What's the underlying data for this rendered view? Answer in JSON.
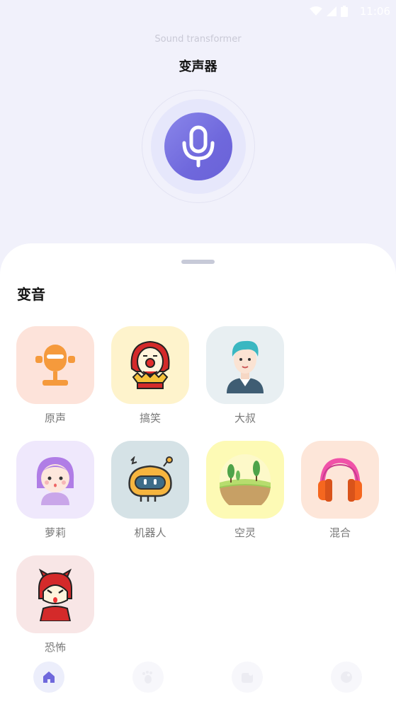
{
  "status": {
    "time": "11:06"
  },
  "header": {
    "subtitle": "Sound transformer",
    "title": "变声器"
  },
  "mic": {
    "icon": "microphone-icon"
  },
  "sheet": {
    "section_title": "变音",
    "effects": [
      {
        "label": "原声",
        "icon": "microphone-icon",
        "bg": "#fde3da"
      },
      {
        "label": "搞笑",
        "icon": "clown-icon",
        "bg": "#fef3cc"
      },
      {
        "label": "大叔",
        "icon": "man-icon",
        "bg": "#e8eff2"
      },
      {
        "label": "萝莉",
        "icon": "girl-icon",
        "bg": "#efe8fc"
      },
      {
        "label": "机器人",
        "icon": "robot-icon",
        "bg": "#d5e2e6"
      },
      {
        "label": "空灵",
        "icon": "landscape-icon",
        "bg": "#fdfab5"
      },
      {
        "label": "混合",
        "icon": "headphones-icon",
        "bg": "#fde6d9"
      },
      {
        "label": "恐怖",
        "icon": "devil-icon",
        "bg": "#f8e6e6"
      }
    ]
  },
  "nav": {
    "items": [
      {
        "icon": "home-icon",
        "active": true
      },
      {
        "icon": "footprint-icon",
        "active": false
      },
      {
        "icon": "folder-icon",
        "active": false
      },
      {
        "icon": "profile-icon",
        "active": false
      }
    ]
  },
  "colors": {
    "accent": "#6f68dc",
    "background": "#f1f1fb"
  }
}
